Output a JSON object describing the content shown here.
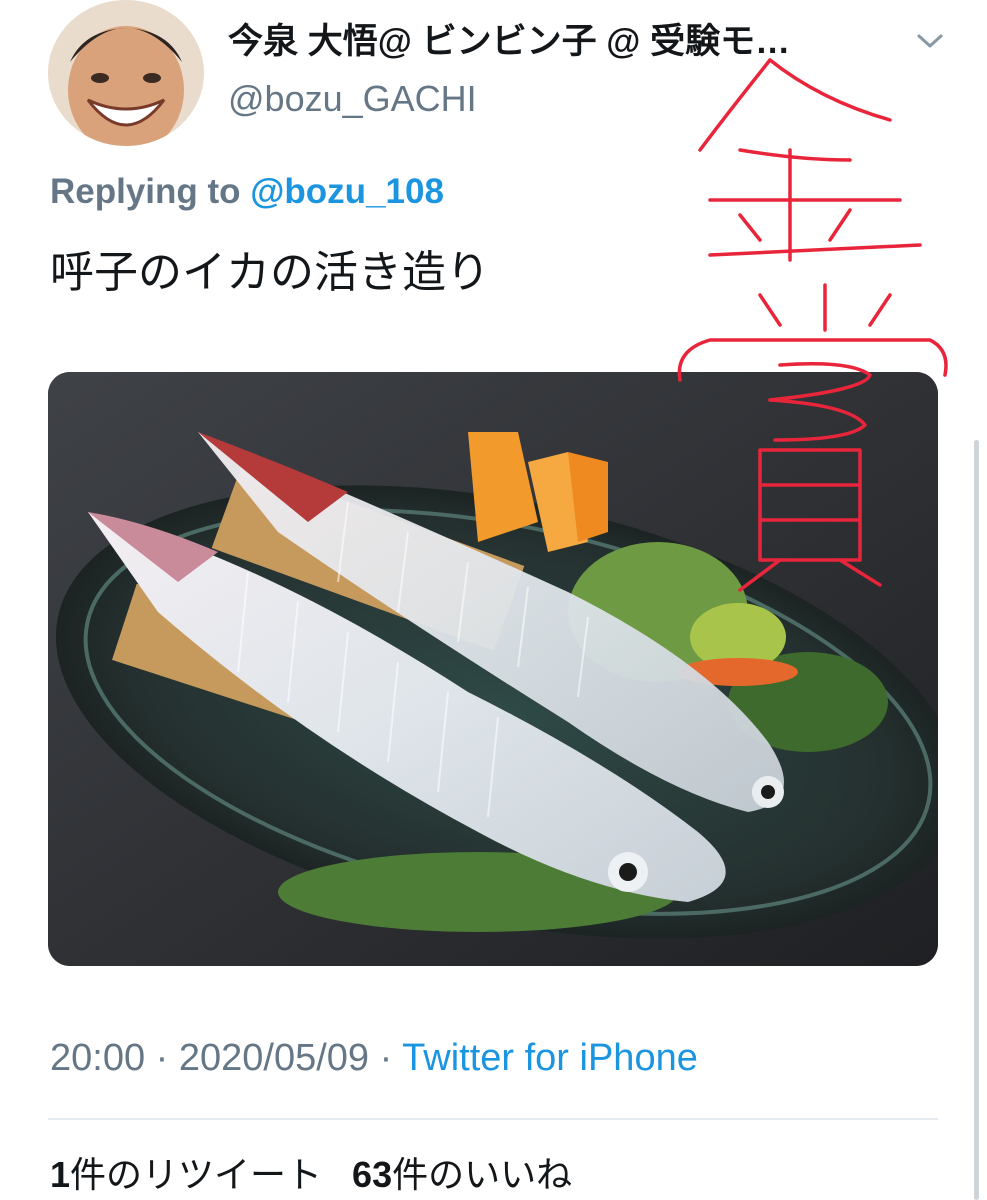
{
  "tweet": {
    "author": {
      "display_name": "今泉 大悟@ ビンビン子 @ 受験モ…",
      "handle": "@bozu_GACHI"
    },
    "replying_to": {
      "prefix": "Replying to",
      "handle": "@bozu_108"
    },
    "text": "呼子のイカの活き造り",
    "meta": {
      "time": "20:00",
      "separator": "·",
      "date": "2020/05/09",
      "source": "Twitter for iPhone"
    },
    "stats": {
      "retweets_count": "1",
      "retweets_label": "件のリツイート",
      "likes_count": "63",
      "likes_label": "件のいいね"
    }
  },
  "overlay": {
    "handwritten_text": "金賞",
    "color": "#e8253a"
  },
  "icons": {
    "caret": "chevron-down-icon"
  },
  "colors": {
    "link": "#1b95e0",
    "secondary_text": "#657786",
    "primary_text": "#14171a",
    "divider": "#e6ecf0"
  }
}
